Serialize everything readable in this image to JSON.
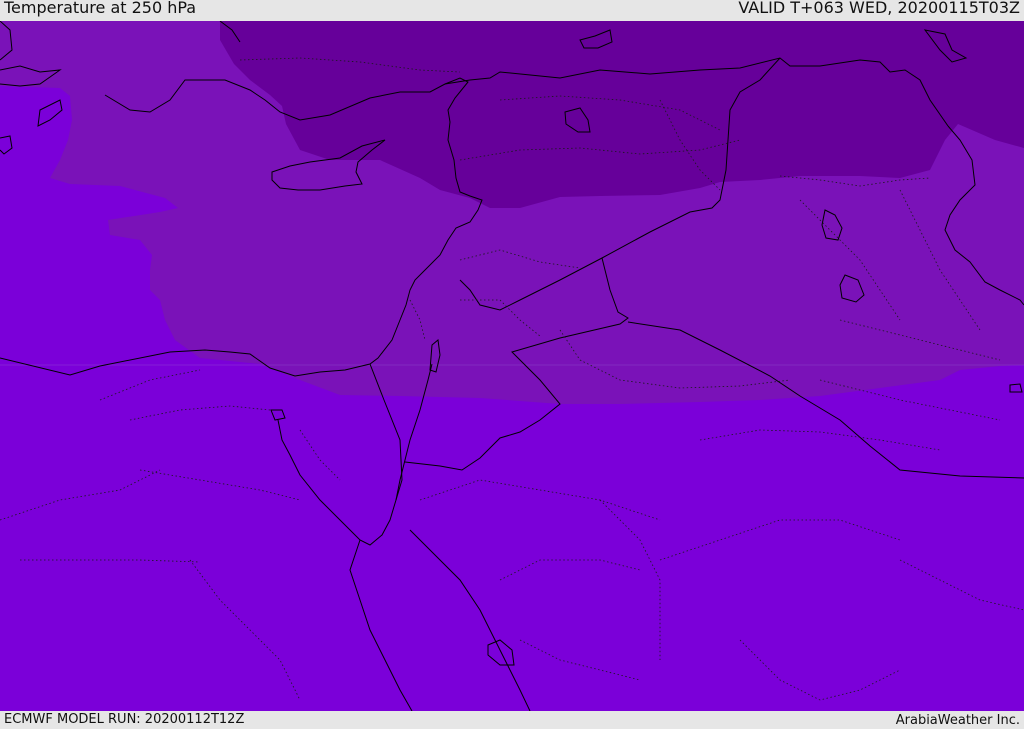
{
  "header": {
    "title": "Temperature at 250 hPa",
    "valid_time": "VALID T+063 WED, 20200115T03Z"
  },
  "footer": {
    "model_run": "ECMWF MODEL RUN: 20200112T12Z",
    "credit": "ArabiaWeather Inc."
  },
  "colors": {
    "band_warm": "#7b00d9",
    "band_mid": "#7a12b8",
    "band_cold": "#66009a",
    "coast": "#000000",
    "bar_bg": "#e6e6e6"
  }
}
